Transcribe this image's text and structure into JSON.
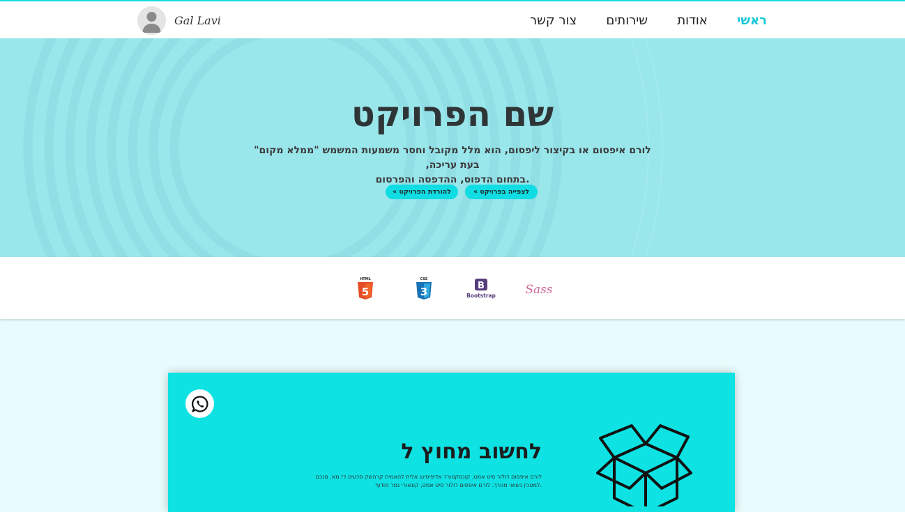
{
  "brand": {
    "name": "Gal Lavi"
  },
  "nav": {
    "items": [
      "ראשי",
      "אודות",
      "שירותים",
      "צור קשר"
    ],
    "active": "ראשי"
  },
  "hero": {
    "title": "שם הפרויקט",
    "subtitle_line1": "לורם איפסום או בקיצור ליפסום, הוא מלל מקובל וחסר משמעות המשמש \"ממלא מקום\" בעת עריכה,",
    "subtitle_line2": ".בתחום הדפוס, ההדפסה והפרסום",
    "btn_view": "לצפייה בפרויקט »",
    "btn_download": "להורדת הפרויקט »"
  },
  "tech_logos": [
    {
      "icon": "html5-icon",
      "label": "HTML"
    },
    {
      "icon": "css3-icon",
      "label": "CSS"
    },
    {
      "icon": "bootstrap-icon",
      "label": "Bootstrap"
    },
    {
      "icon": "sass-icon",
      "label": "Sass"
    }
  ],
  "card": {
    "title": "לחשוב מחוץ ל",
    "text_line1": "לורם איפסום דולור סיט אמט, קונסקטורר אדיפיסינג אלית להאמית קרהשק סכעיט דז מא, מנכם",
    "text_line2": ".למטכין נשואי מנורך. לורם איפסום דולור סיט אמט, קונאורי נמר מודוף"
  },
  "colors": {
    "accent": "#10dde3",
    "hero_bg": "#99e6eb",
    "card_bg": "#0fe2e3",
    "page_bg": "#e9fcfd",
    "nav_active": "#12c9d8"
  }
}
